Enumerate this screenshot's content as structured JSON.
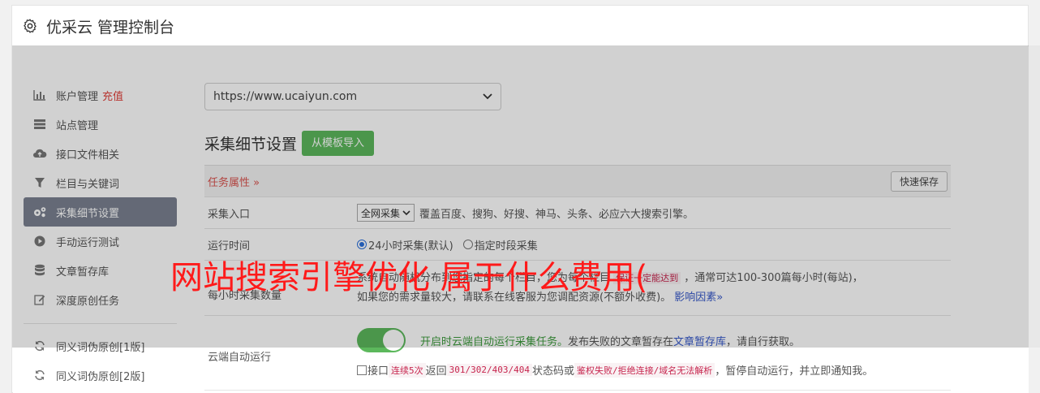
{
  "app": {
    "title": "优采云 管理控制台"
  },
  "sidebar": {
    "items": [
      {
        "icon": "bar-chart-icon",
        "label": "账户管理",
        "tag": "充值"
      },
      {
        "icon": "server-icon",
        "label": "站点管理"
      },
      {
        "icon": "cloud-upload-icon",
        "label": "接口文件相关"
      },
      {
        "icon": "filter-icon",
        "label": "栏目与关键词"
      },
      {
        "icon": "gears-icon",
        "label": "采集细节设置",
        "active": true
      },
      {
        "icon": "play-circle-icon",
        "label": "手动运行测试"
      },
      {
        "icon": "database-icon",
        "label": "文章暂存库"
      },
      {
        "icon": "edit-icon",
        "label": "深度原创任务"
      }
    ],
    "items2": [
      {
        "icon": "refresh-icon",
        "label": "同义词伪原创[1版]"
      },
      {
        "icon": "refresh-icon",
        "label": "同义词伪原创[2版]"
      }
    ]
  },
  "main": {
    "site_select": {
      "value": "https://www.ucaiyun.com"
    },
    "section_title": "采集细节设置",
    "import_button": "从模板导入",
    "task_props": {
      "label": "任务属性 »",
      "save_button": "快速保存"
    },
    "rows": {
      "entry": {
        "key": "采集入口",
        "select": "全网采集",
        "desc": "覆盖百度、搜狗、好搜、神马、头条、必应六大搜索引擎。"
      },
      "time": {
        "key": "运行时间",
        "opt1": "24小时采集(默认)",
        "opt2": "指定时段采集"
      },
      "volume": {
        "key": "每小时采集数量",
        "line1_a": "系统自动随机分布到您指定的每个栏目，您为每个栏目",
        "line1_code": "保证一定能达到",
        "line1_b": "，通常可达100-300篇每小时(每站)，",
        "line2": "如果您的需求量较大，请联系在线客服为您调配资源(不额外收费)。",
        "line2_link": "影响因素»"
      },
      "cloud": {
        "key": "云端自动运行",
        "line1_green": "开启时云端自动运行采集任务。",
        "line1_text": "发布失败的文章暂存在",
        "line1_link": "文章暂存库",
        "line1_end": "，请自行获取。",
        "line2_a": "接口",
        "line2_code1": "连续5次",
        "line2_b": "返回",
        "line2_code2": "301/302/403/404",
        "line2_c": "状态码或",
        "line2_code3": "鉴权失败/拒绝连接/域名无法解析",
        "line2_d": "，暂停自动运行，并立即通知我。"
      }
    }
  },
  "overlay": {
    "text": "网站搜索引擎优化 属于什么费用("
  }
}
